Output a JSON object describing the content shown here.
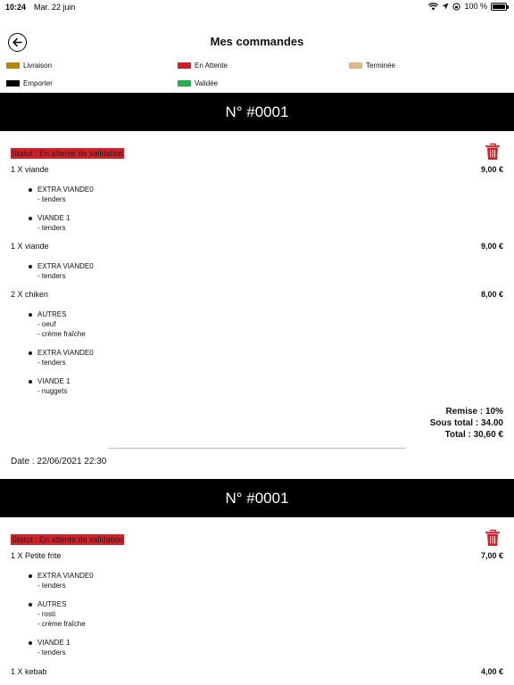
{
  "status_bar": {
    "time": "10:24",
    "date": "Mar. 22 juin",
    "battery": "100 %"
  },
  "header": {
    "title": "Mes commandes"
  },
  "legend": [
    {
      "label": "Livraison",
      "color": "#b8860b"
    },
    {
      "label": "En Attente",
      "color": "#d0202a"
    },
    {
      "label": "Terminée",
      "color": "#deb887"
    },
    {
      "label": "Emporter",
      "color": "#000000"
    },
    {
      "label": "Validée",
      "color": "#22b14c"
    }
  ],
  "orders": [
    {
      "number": "N° #0001",
      "status": "Statut : En attente de validation",
      "status_color": "#d0202a",
      "items": [
        {
          "name": "1 X viande",
          "price": "9,00 €",
          "options": [
            {
              "group": "EXTRA VIANDE0",
              "details": [
                "- tenders"
              ]
            },
            {
              "group": "VIANDE 1",
              "details": [
                "- tenders"
              ]
            }
          ]
        },
        {
          "name": "1 X viande",
          "price": "9,00 €",
          "options": [
            {
              "group": "EXTRA VIANDE0",
              "details": [
                "- tenders"
              ]
            }
          ]
        },
        {
          "name": "2 X chiken",
          "price": "8,00 €",
          "options": [
            {
              "group": "AUTRES",
              "details": [
                "- oeuf",
                "- crème fraîche"
              ]
            },
            {
              "group": "EXTRA VIANDE0",
              "details": [
                "- tenders"
              ]
            },
            {
              "group": "VIANDE 1",
              "details": [
                "- nuggets"
              ]
            }
          ]
        }
      ],
      "remise": "Remise : 10%",
      "sous_total": "Sous total : 34.00",
      "total": "Total : 30,60 €",
      "date": "Date : 22/06/2021 22:30"
    },
    {
      "number": "N° #0001",
      "status": "Statut : En attente de validation",
      "status_color": "#d0202a",
      "items": [
        {
          "name": "1 X Petite frite",
          "price": "7,00 €",
          "options": [
            {
              "group": "EXTRA VIANDE0",
              "details": [
                "- tenders"
              ]
            },
            {
              "group": "AUTRES",
              "details": [
                "- rosti",
                "- crème fraîche"
              ]
            },
            {
              "group": "VIANDE 1",
              "details": [
                "- tenders"
              ]
            }
          ]
        },
        {
          "name": "1 X kebab",
          "price": "4,00 €",
          "options": []
        }
      ]
    }
  ]
}
